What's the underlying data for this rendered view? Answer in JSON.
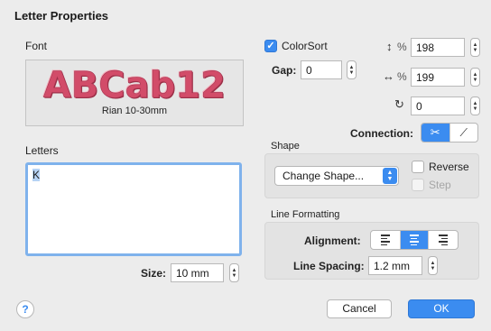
{
  "dialog": {
    "title": "Letter Properties"
  },
  "font": {
    "label": "Font",
    "preview_text": "ABCab12",
    "preview_name": "Rian 10-30mm"
  },
  "letters": {
    "label": "Letters",
    "value": "K"
  },
  "size": {
    "label": "Size:",
    "value": "10 mm"
  },
  "colorsort": {
    "label": "ColorSort",
    "checked": true
  },
  "gap": {
    "label": "Gap:",
    "value": "0"
  },
  "height_pct": {
    "icon": "vertical-scale-icon",
    "symbol": "%",
    "value": "198"
  },
  "width_pct": {
    "icon": "horizontal-scale-icon",
    "symbol": "%",
    "value": "199"
  },
  "rotation": {
    "icon": "rotate-icon",
    "value": "0"
  },
  "connection": {
    "label": "Connection:",
    "options": [
      "scissors-icon",
      "line-icon"
    ],
    "selected": 0
  },
  "shape": {
    "group_label": "Shape",
    "popup_value": "Change Shape...",
    "reverse_label": "Reverse",
    "step_label": "Step"
  },
  "line_formatting": {
    "group_label": "Line Formatting",
    "alignment_label": "Alignment:",
    "alignment_selected": "center",
    "line_spacing_label": "Line Spacing:",
    "line_spacing_value": "1.2 mm"
  },
  "buttons": {
    "cancel": "Cancel",
    "ok": "OK",
    "help": "?"
  },
  "colors": {
    "accent": "#3b8cf0",
    "preview_text": "#d24c69"
  }
}
